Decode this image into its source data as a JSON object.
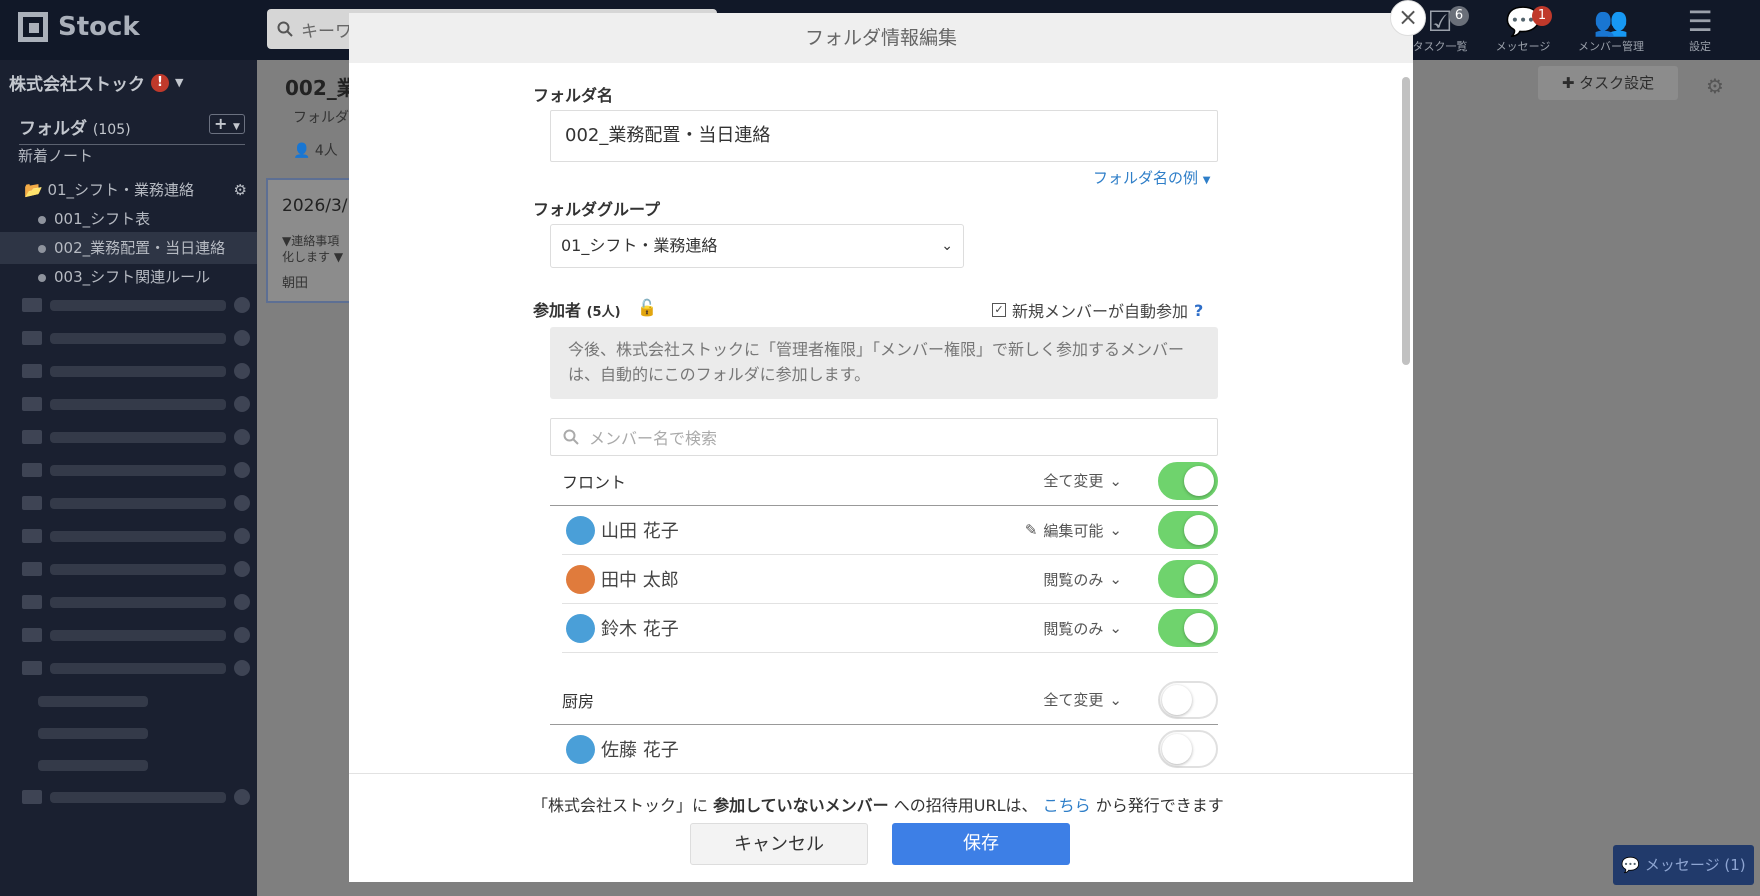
{
  "topbar": {
    "brand": "Stock",
    "search_placeholder": "キーワ",
    "nav": [
      {
        "label": "タスク一覧",
        "badge": "6",
        "icon": "task-check-icon"
      },
      {
        "label": "メッセージ",
        "badge": "1",
        "icon": "chat-bubble-icon"
      },
      {
        "label": "メンバー管理",
        "badge": "",
        "icon": "members-icon"
      },
      {
        "label": "設定",
        "badge": "",
        "icon": "hamburger-menu-icon"
      }
    ]
  },
  "sidebar": {
    "company": "株式会社ストック",
    "alert": "!",
    "folder_heading": "フォルダ",
    "folder_count": "(105)",
    "add_label": "+",
    "new_notes": "新着ノート",
    "group": "01_シフト・業務連絡",
    "items": [
      "001_シフト表",
      "002_業務配置・当日連絡",
      "003_シフト関連ルール"
    ]
  },
  "background": {
    "page_title": "002_業",
    "sub": "フォルダ",
    "members": "4人",
    "card_date": "2026/3/",
    "card_text1": "▼連絡事項",
    "card_text2": "化します ▼",
    "card_author": "朝田",
    "task_settings": "タスク設定",
    "message_button": "メッセージ (1)"
  },
  "modal": {
    "title": "フォルダ情報編集",
    "close": "×",
    "folder_name_label": "フォルダ名",
    "folder_name_value": "002_業務配置・当日連絡",
    "folder_name_example": "フォルダ名の例",
    "group_label": "フォルダグループ",
    "group_value": "01_シフト・業務連絡",
    "participants_label": "参加者",
    "participants_count": "(5人)",
    "auto_join_label": "新規メンバーが自動参加",
    "help": "?",
    "info_text": "今後、株式会社ストックに「管理者権限」「メンバー権限」で新しく参加するメンバーは、自動的にこのフォルダに参加します。",
    "member_search_placeholder": "メンバー名で検索",
    "groups": [
      {
        "name": "フロント",
        "change_all": "全て変更",
        "enabled": true,
        "members": [
          {
            "name": "山田 花子",
            "permission": "編集可能",
            "enabled": true,
            "color": "#4a9fd8",
            "edit_icon": true
          },
          {
            "name": "田中 太郎",
            "permission": "閲覧のみ",
            "enabled": true,
            "color": "#e07b3c",
            "edit_icon": false
          },
          {
            "name": "鈴木 花子",
            "permission": "閲覧のみ",
            "enabled": true,
            "color": "#4a9fd8",
            "edit_icon": false
          }
        ]
      },
      {
        "name": "厨房",
        "change_all": "全て変更",
        "enabled": false,
        "members": [
          {
            "name": "佐藤 花子",
            "permission": "",
            "enabled": false,
            "color": "#4a9fd8",
            "edit_icon": false
          }
        ]
      }
    ],
    "footer": {
      "note_pre": "「株式会社ストック」に",
      "note_bold": "参加していないメンバー",
      "note_mid": "への招待用URLは、",
      "note_link": "こちら",
      "note_post": "から発行できます",
      "cancel": "キャンセル",
      "save": "保存"
    }
  },
  "colors": {
    "topbar_bg": "#111828",
    "sidebar_bg": "#1a2030",
    "toggle_on": "#6fd36d",
    "primary": "#3d7fe6",
    "link": "#2e7ec8"
  }
}
